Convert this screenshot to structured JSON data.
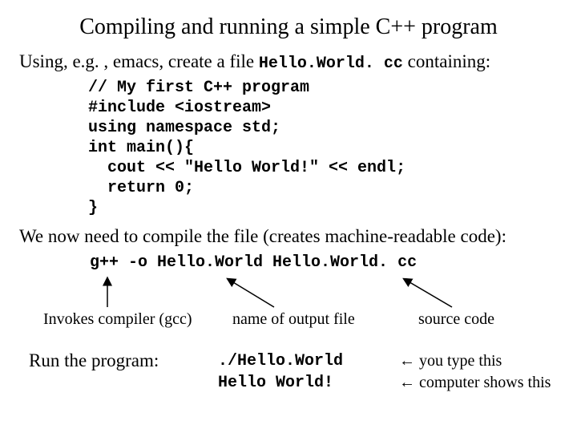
{
  "title": "Compiling and running a simple C++ program",
  "intro": {
    "prefix": "Using, e.g. , emacs, create a file ",
    "filename": "Hello.World. cc",
    "suffix": " containing:"
  },
  "program": "// My first C++ program\n#include <iostream>\nusing namespace std;\nint main(){\n  cout << \"Hello World!\" << endl;\n  return 0;\n}",
  "compile_text": "We now need to compile the file (creates machine-readable code):",
  "compile_cmd": "g++ -o Hello.World Hello.World. cc",
  "annotations": {
    "compiler": "Invokes compiler (gcc)",
    "output": "name of output file",
    "source": "source code"
  },
  "run": {
    "label": "Run the program:",
    "cmd": "./Hello.World",
    "out": "Hello World!",
    "note1": "← you type this",
    "note2": "← computer shows this"
  }
}
